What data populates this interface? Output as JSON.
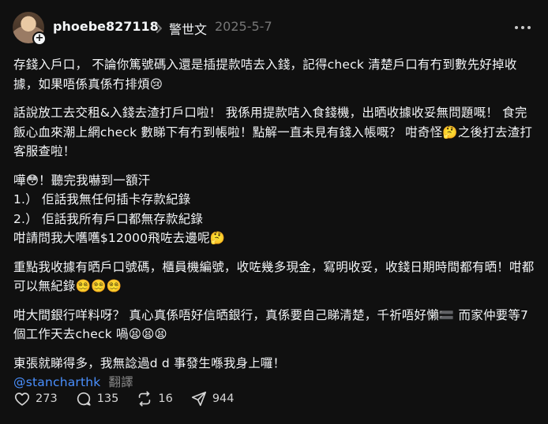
{
  "post": {
    "username": "phoebe827118",
    "topic": "警世文",
    "date": "2025-5-7",
    "paragraphs": [
      "存錢入戶口， 不論你篤號碼入還是插提款咭去入錢，記得check 清楚戶口有冇到數先好掉收據，如果唔係真係冇排煩😢",
      "話說放工去交租&入錢去渣打戶口啦！ 我係用提款咭入食錢機，出晒收據收妥無問題嘅！ 食完飯心血來潮上網check 數睇下有冇到帳啦！點解一直未見有錢入帳嘅？ 咁奇怪🤔之後打去渣打客服查啦！",
      "嘩😳！聽完我嚇到一額汗",
      "1.） 佢話我無任何插卡存款紀錄",
      "2.） 佢話我所有戶口都無存款紀錄",
      "咁請問我大嚿嚿$12000飛咗去邊呢🤔",
      "重點我收據有晒戶口號碼，櫃員機編號，收咗幾多現金，寫明收妥，收錢日期時間都有晒！咁都可以無紀錄😵‍💫😵‍💫😵‍💫",
      "咁大間銀行咩料呀？ 真心真係唔好信晒銀行，真係要自己睇清楚，千祈唔好懶🟰 而家仲要等7個工作天去check 喎😫😫😫",
      "東張就睇得多，我無諗過d d 事發生喺我身上囉！"
    ],
    "mention": "@stancharthk",
    "translate_label": "翻譯"
  },
  "actions": {
    "likes": "273",
    "comments": "135",
    "reposts": "16",
    "shares": "944"
  },
  "icons": {
    "more": "more-horizontal-icon",
    "like": "heart-icon",
    "comment": "comment-icon",
    "repost": "repost-icon",
    "share": "send-icon"
  },
  "colors": {
    "background": "#101010",
    "text": "#f3f5f7",
    "muted": "#777777",
    "mention": "#4a90ff"
  }
}
